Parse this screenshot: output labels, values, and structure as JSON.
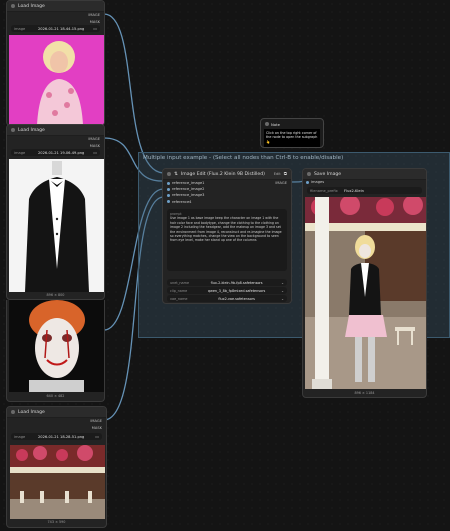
{
  "load_image_1": {
    "title": "Load Image",
    "outputs": [
      "IMAGE",
      "MASK"
    ],
    "image_label": "image",
    "image_value": "2026-01-21 18-44-15.png"
  },
  "load_image_2": {
    "title": "Load Image",
    "outputs": [
      "IMAGE",
      "MASK"
    ],
    "image_label": "image",
    "image_value": "2026-01-21 19-06-49.png",
    "size_caption": "896 × 800"
  },
  "load_image_3": {
    "size_caption": "640 × 482"
  },
  "load_image_4": {
    "title": "Load Image",
    "outputs": [
      "IMAGE",
      "MASK"
    ],
    "image_label": "image",
    "image_value": "2026-01-21 18-28-51.png",
    "size_caption": "743 × 590"
  },
  "note": {
    "title": "Note",
    "text": "Click on the top right corner of the node to open the subgraph 👆"
  },
  "group": {
    "title": "Multiple input example - (Select all nodes than Ctrl-B to enable/disable)"
  },
  "image_edit": {
    "title": "Image Edit (Flux.2 Klein 9B Distilled)",
    "tab": "Edit",
    "output": "IMAGE",
    "inputs": [
      "reference_image1",
      "reference_image2",
      "reference_image3",
      "reference4"
    ],
    "prompt_label": "prompt",
    "prompt_text": "Use image 1 as base image keep the character on image 1 with the hair color face and bodytype, change the clothing to the clothing on image 2 including the headgear, add the makeup on image 3 and set the environment from image 4, reconstruct and re-imagine the image so everything matches, change the view on the background to seen from eye level, make her stand up one of the columns",
    "selects": [
      {
        "label": "unet_name",
        "value": "flux-2-klein-9b-fp8.safetensors"
      },
      {
        "label": "clip_name",
        "value": "qwen_3_8b_fp8mixed.safetensors"
      },
      {
        "label": "vae_name",
        "value": "flux2-vae.safetensors"
      }
    ]
  },
  "save_image": {
    "title": "Save Image",
    "input": "images",
    "prefix_label": "filename_prefix",
    "prefix_value": "Flux2-Klein",
    "size_caption": "896 × 1184"
  },
  "colors": {
    "wire": "#6ea0c8",
    "group_border": "#3c5a6e",
    "canvas": "#141414",
    "node": "#232323"
  }
}
